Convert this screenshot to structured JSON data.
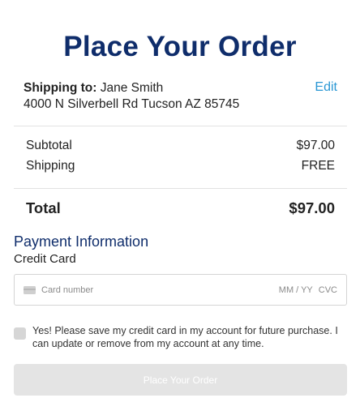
{
  "page": {
    "title": "Place Your Order"
  },
  "shipping": {
    "label": "Shipping to:",
    "name": "Jane Smith",
    "address": "4000 N Silverbell Rd Tucson AZ 85745",
    "edit_label": "Edit"
  },
  "summary": {
    "subtotal_label": "Subtotal",
    "subtotal_value": "$97.00",
    "shipping_label": "Shipping",
    "shipping_value": "FREE",
    "total_label": "Total",
    "total_value": "$97.00"
  },
  "payment": {
    "title": "Payment Information",
    "method_label": "Credit Card",
    "card_number_placeholder": "Card number",
    "expiry_placeholder": "MM / YY",
    "cvc_placeholder": "CVC",
    "card_icon": "credit-card-icon"
  },
  "save_card": {
    "checked": false,
    "text": "Yes! Please save my credit card in my account for future purchase. I can update or remove from my account at any time."
  },
  "actions": {
    "place_order_label": "Place Your Order"
  },
  "colors": {
    "title": "#0f2d6b",
    "link": "#2a97d4",
    "button_disabled": "#e4e4e4"
  }
}
